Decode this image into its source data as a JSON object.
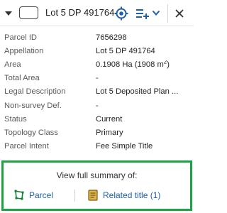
{
  "header": {
    "title": "Lot 5 DP 491764"
  },
  "properties": [
    {
      "label": "Parcel ID",
      "value": "7656298"
    },
    {
      "label": "Appellation",
      "value": "Lot 5 DP 491764"
    },
    {
      "label": "Area",
      "value": "0.1908 Ha (1908 m",
      "value_sup": "2",
      "value_suffix": ")"
    },
    {
      "label": "Total Area",
      "value": "-"
    },
    {
      "label": "Legal Description",
      "value": "Lot 5 Deposited Plan ..."
    },
    {
      "label": "Non-survey Def.",
      "value": "-"
    },
    {
      "label": "Status",
      "value": "Current"
    },
    {
      "label": "Topology Class",
      "value": "Primary"
    },
    {
      "label": "Parcel Intent",
      "value": "Fee Simple Title"
    }
  ],
  "summary": {
    "heading": "View full summary of:",
    "parcel_link": "Parcel",
    "title_link": "Related title (1)"
  },
  "colors": {
    "accent": "#1f5fa6",
    "highlight_border": "#1fa149"
  },
  "icons": [
    "chevron-down-icon",
    "color-swatch",
    "target-icon",
    "add-to-list-icon",
    "chevron-down-icon",
    "close-icon",
    "parcel-polygon-icon",
    "title-document-icon"
  ]
}
